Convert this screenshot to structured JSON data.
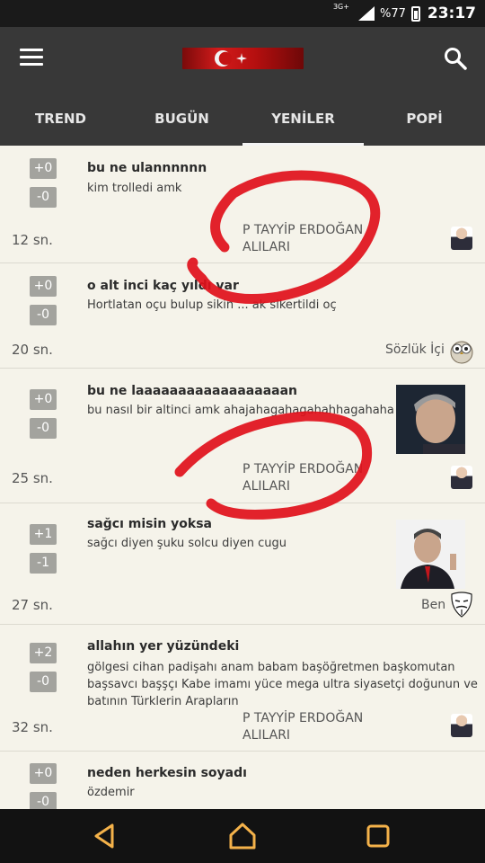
{
  "status_bar": {
    "network": "3G+",
    "battery": "%77",
    "time": "23:17"
  },
  "app_bar": {
    "logo": "turkish-flag-logo",
    "menu_icon": "hamburger-icon",
    "search_icon": "search-icon"
  },
  "tabs": [
    {
      "label": "TREND"
    },
    {
      "label": "BUGÜN"
    },
    {
      "label": "YENİLER",
      "active": true
    },
    {
      "label": "POPİ"
    }
  ],
  "items": [
    {
      "up": "+0",
      "down": "-0",
      "title": "bu ne ulannnnnn",
      "snippet": "kim trolledi amk",
      "time": "12 sn.",
      "author_line1": "P TAYYİP ERDOĞAN",
      "author_line2": "ALILARI"
    },
    {
      "up": "+0",
      "down": "-0",
      "title": "o alt inci kaç yıldı var",
      "snippet": "Hortlatan oçu bulup sikin ... ak sikertildi oç",
      "time": "20 sn.",
      "author_line1": "Sözlük İçi",
      "author_line2": ""
    },
    {
      "up": "+0",
      "down": "-0",
      "title": "bu ne laaaaaaaaaaaaaaaaaan",
      "snippet": "bu nasıl bir altinci amk ahajahagahagahahhagahaha",
      "time": "25 sn.",
      "author_line1": "P TAYYİP ERDOĞAN",
      "author_line2": "ALILARI"
    },
    {
      "up": "+1",
      "down": "-1",
      "title": "sağcı misin yoksa",
      "snippet": "sağcı diyen şuku solcu diyen cugu",
      "time": "27 sn.",
      "author_line1": "Ben",
      "author_line2": ""
    },
    {
      "up": "+2",
      "down": "-0",
      "title": "allahın yer yüzündeki",
      "snippet_lines": [
        "gölgesi cihan padişahı anam babam başöğretmen başkomutan",
        "başsavcı başşçı Kabe imamı yüce mega ultra siyasetçi doğunun ve",
        "batının Türklerin Arapların"
      ],
      "time": "32 sn.",
      "author_line1": "P TAYYİP ERDOĞAN",
      "author_line2": "ALILARI"
    },
    {
      "up": "+0",
      "down": "-0",
      "title": "neden herkesin soyadı",
      "snippet": "özdemir"
    }
  ],
  "colors": {
    "appbar": "#383838",
    "background": "#f5f3ea",
    "annotation": "#e0101a"
  }
}
